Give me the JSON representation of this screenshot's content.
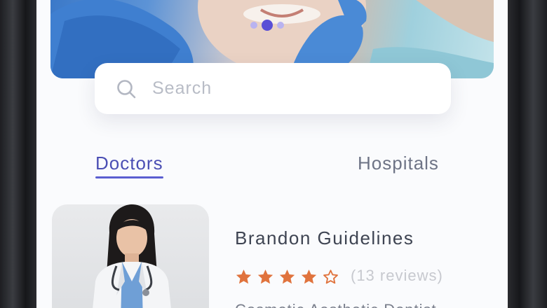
{
  "search": {
    "placeholder": "Search",
    "icon": "search-icon"
  },
  "carousel": {
    "page_count": 3,
    "active_index": 1
  },
  "tabs": [
    {
      "label": "Doctors",
      "active": true
    },
    {
      "label": "Hospitals",
      "active": false
    }
  ],
  "doctor": {
    "name": "Brandon Guidelines",
    "rating": 4,
    "max_rating": 5,
    "reviews": "(13 reviews)",
    "specialty_partial": "Cosmetic Aesthetic Dentist"
  },
  "colors": {
    "accent": "#4b4fb4",
    "star": "#e0733d",
    "dot_active": "#5a4fd6",
    "dot_inactive": "#b9b3f0"
  }
}
